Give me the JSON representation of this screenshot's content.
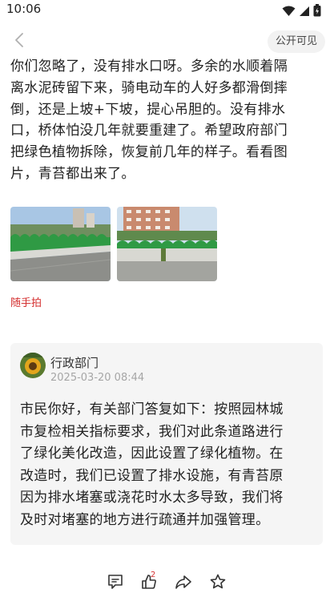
{
  "status_bar": {
    "time": "10:06"
  },
  "header": {
    "visibility_label": "公开可见"
  },
  "post": {
    "lines": [
      "你们忽略了，没有排水口呀。多余的水顺着隔",
      "离水泥砖留下来，骑电动车的人好多都滑倒摔",
      "倒，还是上坡+下坡，提心吊胆的。没有排水",
      "口，桥体怕没几年就要重建了。希望政府部门",
      "把绿色植物拆除，恢复前几年的样子。看看图",
      "片，青苔都出来了。"
    ],
    "tag": "随手拍"
  },
  "reply": {
    "name": "行政部门",
    "time": "2025-03-20 08:44",
    "lines": [
      "市民你好，有关部门答复如下：按照园林城",
      "市复检相关指标要求，我们对此条道路进行",
      "了绿化美化改造，因此设置了绿化植物。在",
      "改造时，我们已设置了排水设施，有青苔原",
      "因为排水堵塞或浇花时水太多导致，我们将",
      "及时对堵塞的地方进行疏通并加强管理。"
    ]
  },
  "actions": {
    "like_count": "2"
  },
  "colors": {
    "accent": "#d43030",
    "card_bg": "#f5f5f5",
    "pill_bg": "#f2f2f2",
    "muted": "#a6a6a6"
  }
}
